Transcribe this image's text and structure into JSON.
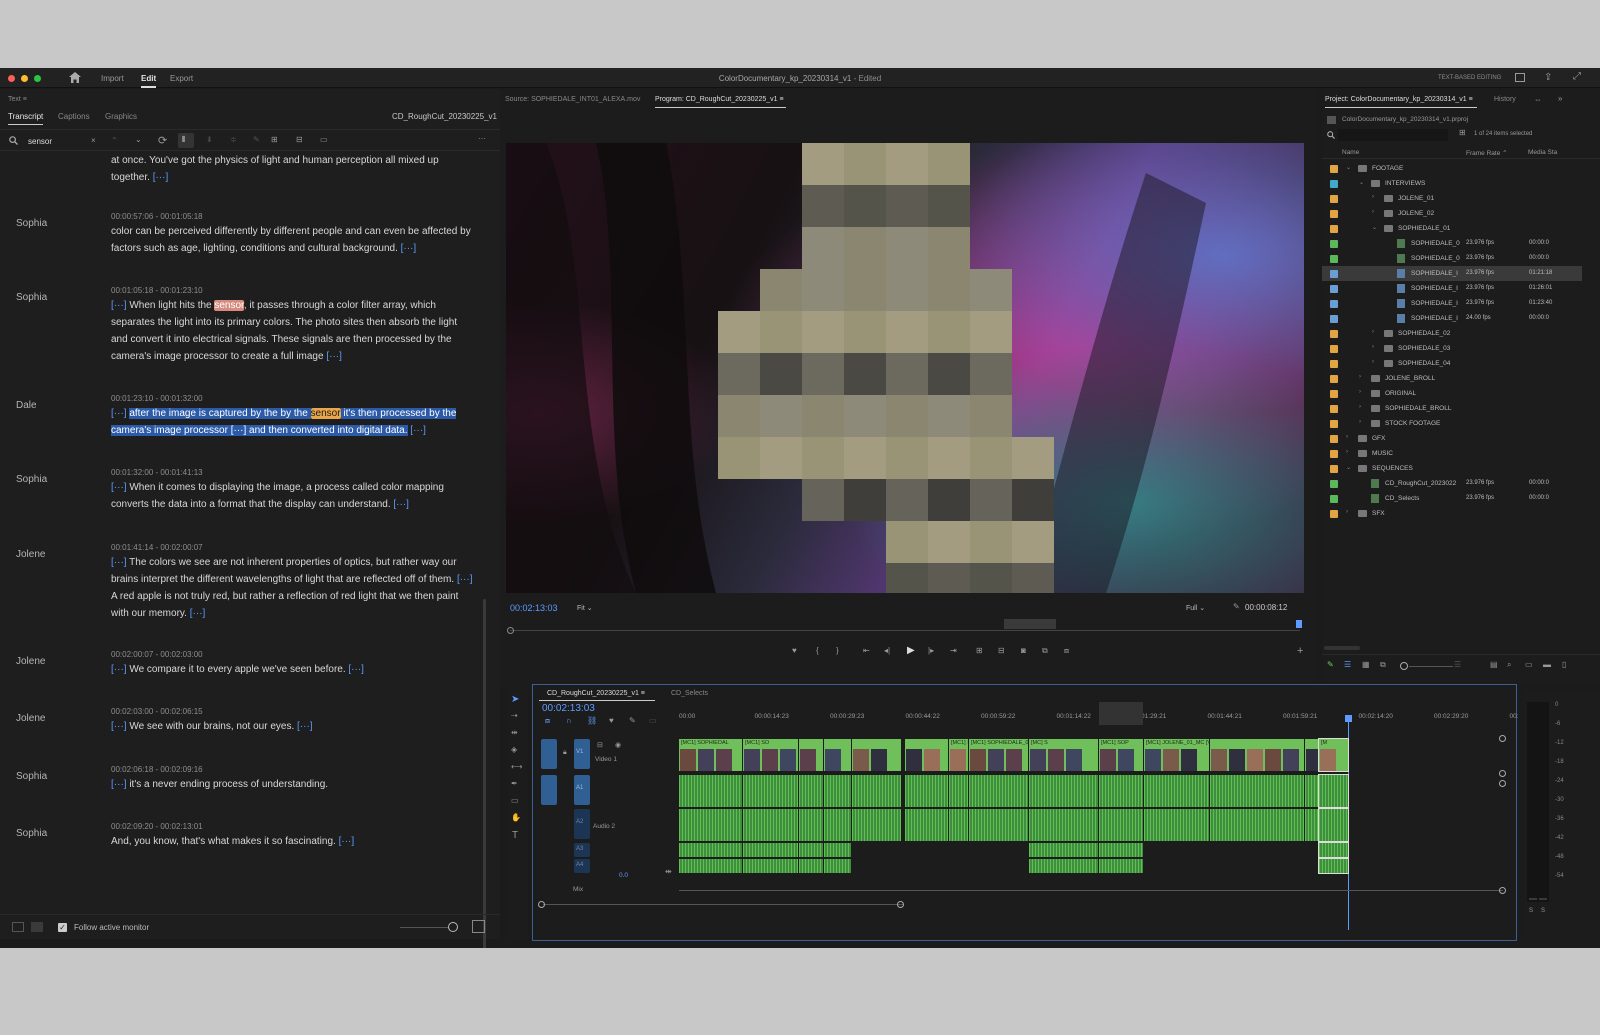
{
  "window": {
    "title": "ColorDocumentary_kp_20230314_v1",
    "status": "- Edited",
    "tabs": [
      "Import",
      "Edit",
      "Export"
    ],
    "active_tab": "Edit",
    "text_based_editing": "TEXT-BASED EDITING"
  },
  "text_panel": {
    "label": "Text",
    "tabs": [
      "Transcript",
      "Captions",
      "Graphics"
    ],
    "sequence_name": "CD_RoughCut_20230225_v1",
    "search_value": "sensor",
    "follow_label": "Follow active monitor",
    "segments": [
      {
        "speaker": "",
        "time": "",
        "parts": [
          {
            "t": "at once. You've got the physics of light and human perception all mixed up together. "
          },
          {
            "t": "[···]",
            "c": "gap"
          }
        ]
      },
      {
        "speaker": "Sophia",
        "time": "00:00:57:06 - 00:01:05:18",
        "parts": [
          {
            "t": "color can be perceived differently by different people and can even be affected by factors such as age, lighting, conditions and cultural background. "
          },
          {
            "t": "[···]",
            "c": "gap"
          }
        ]
      },
      {
        "speaker": "Sophia",
        "time": "00:01:05:18 - 00:01:23:10",
        "parts": [
          {
            "t": "[···] ",
            "c": "gap"
          },
          {
            "t": "When light hits the "
          },
          {
            "t": "sensor",
            "c": "hit"
          },
          {
            "t": ", it passes through a color filter array, which separates the light into its primary colors. The photo sites then absorb the light and convert it into electrical signals. These signals are then processed by the camera's image processor to create a full image "
          },
          {
            "t": "[···]",
            "c": "gap"
          }
        ]
      },
      {
        "speaker": "Dale",
        "time": "00:01:23:10 - 00:01:32:00",
        "parts": [
          {
            "t": "[···] ",
            "c": "gap"
          },
          {
            "t": "after the image is captured by the by the ",
            "c": "hl"
          },
          {
            "t": "sensor",
            "c": "hit2"
          },
          {
            "t": " it's then processed by the camera's image processor ",
            "c": "hl"
          },
          {
            "t": "[···]",
            "c": "gap hl"
          },
          {
            "t": " and then converted into digital data.",
            "c": "hl"
          },
          {
            "t": " [···]",
            "c": "gap"
          }
        ]
      },
      {
        "speaker": "Sophia",
        "time": "00:01:32:00 - 00:01:41:13",
        "parts": [
          {
            "t": "[···] ",
            "c": "gap"
          },
          {
            "t": "When it comes to displaying the image, a process called color mapping converts the data into a format that the display can understand. "
          },
          {
            "t": "[···]",
            "c": "gap"
          }
        ]
      },
      {
        "speaker": "Jolene",
        "time": "00:01:41:14 - 00:02:00:07",
        "parts": [
          {
            "t": "[···] ",
            "c": "gap"
          },
          {
            "t": "The colors we see are not inherent properties of optics, but rather way our brains interpret the different wavelengths of light that are reflected off of them. "
          },
          {
            "t": "[···] ",
            "c": "gap"
          },
          {
            "t": "A red apple is not truly red, but rather a reflection of red light that we then paint with our memory. "
          },
          {
            "t": "[···]",
            "c": "gap"
          }
        ]
      },
      {
        "speaker": "Jolene",
        "time": "00:02:00:07 - 00:02:03:00",
        "parts": [
          {
            "t": "[···] ",
            "c": "gap"
          },
          {
            "t": "We compare it to every apple we've seen before. "
          },
          {
            "t": "[···]",
            "c": "gap"
          }
        ]
      },
      {
        "speaker": "Jolene",
        "time": "00:02:03:00 - 00:02:06:15",
        "parts": [
          {
            "t": "[···] ",
            "c": "gap"
          },
          {
            "t": "We see with our brains, not our eyes. "
          },
          {
            "t": "[···]",
            "c": "gap"
          }
        ]
      },
      {
        "speaker": "Sophia",
        "time": "00:02:06:18 - 00:02:09:16",
        "parts": [
          {
            "t": "[···] ",
            "c": "gap"
          },
          {
            "t": "it's a never ending process of understanding."
          }
        ]
      },
      {
        "speaker": "Sophia",
        "time": "00:02:09:20 - 00:02:13:01",
        "parts": [
          {
            "t": "And, you know, that's what makes it so fascinating. "
          },
          {
            "t": "[···]",
            "c": "gap"
          }
        ]
      }
    ]
  },
  "program_monitor": {
    "source_label": "Source: SOPHIEDALE_INT01_ALEXA.mov",
    "program_label": "Program: CD_RoughCut_20230225_v1",
    "timecode": "00:02:13:03",
    "fit": "Fit",
    "quality": "Full",
    "duration": "00:00:08:12"
  },
  "project_panel": {
    "title": "Project: ColorDocumentary_kp_20230314_v1",
    "history": "History",
    "file": "ColorDocumentary_kp_20230314_v1.prproj",
    "selection": "1 of 24 items selected",
    "columns": [
      "Name",
      "Frame Rate",
      "Media Sta"
    ],
    "rows": [
      {
        "name": "FOOTAGE",
        "depth": 0,
        "kind": "folder",
        "open": true,
        "color": "#e2a544",
        "fps": "",
        "start": ""
      },
      {
        "name": "INTERVIEWS",
        "depth": 1,
        "kind": "folder",
        "open": true,
        "color": "#3fa9c9",
        "fps": "",
        "start": ""
      },
      {
        "name": "JOLENE_01",
        "depth": 2,
        "kind": "folder",
        "open": false,
        "color": "#e2a544",
        "fps": "",
        "start": ""
      },
      {
        "name": "JOLENE_02",
        "depth": 2,
        "kind": "folder",
        "open": false,
        "color": "#e2a544",
        "fps": "",
        "start": ""
      },
      {
        "name": "SOPHIEDALE_01",
        "depth": 2,
        "kind": "folder",
        "open": true,
        "color": "#e2a544",
        "fps": "",
        "start": ""
      },
      {
        "name": "SOPHIEDALE_0",
        "depth": 3,
        "kind": "seq",
        "color": "#5cb85c",
        "fps": "23.976 fps",
        "start": "00:00:0"
      },
      {
        "name": "SOPHIEDALE_0",
        "depth": 3,
        "kind": "seq",
        "color": "#5cb85c",
        "fps": "23.976 fps",
        "start": "00:00:0"
      },
      {
        "name": "SOPHIEDALE_I",
        "depth": 3,
        "kind": "clip",
        "color": "#6b9fd4",
        "fps": "23.976 fps",
        "start": "01:21:18",
        "selected": true
      },
      {
        "name": "SOPHIEDALE_I",
        "depth": 3,
        "kind": "clip",
        "color": "#6b9fd4",
        "fps": "23.976 fps",
        "start": "01:26:01"
      },
      {
        "name": "SOPHIEDALE_I",
        "depth": 3,
        "kind": "clip",
        "color": "#6b9fd4",
        "fps": "23.976 fps",
        "start": "01:23:40"
      },
      {
        "name": "SOPHIEDALE_I",
        "depth": 3,
        "kind": "clip",
        "color": "#6b9fd4",
        "fps": "24.00 fps",
        "start": "00:00:0"
      },
      {
        "name": "SOPHIEDALE_02",
        "depth": 2,
        "kind": "folder",
        "open": false,
        "color": "#e2a544",
        "fps": "",
        "start": ""
      },
      {
        "name": "SOPHIEDALE_03",
        "depth": 2,
        "kind": "folder",
        "open": false,
        "color": "#e2a544",
        "fps": "",
        "start": ""
      },
      {
        "name": "SOPHIEDALE_04",
        "depth": 2,
        "kind": "folder",
        "open": false,
        "color": "#e2a544",
        "fps": "",
        "start": ""
      },
      {
        "name": "JOLENE_BROLL",
        "depth": 1,
        "kind": "folder",
        "open": false,
        "color": "#e2a544",
        "fps": "",
        "start": ""
      },
      {
        "name": "ORIGINAL",
        "depth": 1,
        "kind": "folder",
        "open": false,
        "color": "#e2a544",
        "fps": "",
        "start": ""
      },
      {
        "name": "SOPHIEDALE_BROLL",
        "depth": 1,
        "kind": "folder",
        "open": false,
        "color": "#e2a544",
        "fps": "",
        "start": ""
      },
      {
        "name": "STOCK FOOTAGE",
        "depth": 1,
        "kind": "folder",
        "open": false,
        "color": "#e2a544",
        "fps": "",
        "start": ""
      },
      {
        "name": "GFX",
        "depth": 0,
        "kind": "folder",
        "open": false,
        "color": "#e2a544",
        "fps": "",
        "start": ""
      },
      {
        "name": "MUSIC",
        "depth": 0,
        "kind": "folder",
        "open": false,
        "color": "#e2a544",
        "fps": "",
        "start": ""
      },
      {
        "name": "SEQUENCES",
        "depth": 0,
        "kind": "folder",
        "open": true,
        "color": "#e2a544",
        "fps": "",
        "start": ""
      },
      {
        "name": "CD_RoughCut_2023022",
        "depth": 1,
        "kind": "seq",
        "color": "#5cb85c",
        "fps": "23.976 fps",
        "start": "00:00:0"
      },
      {
        "name": "CD_Selects",
        "depth": 1,
        "kind": "seq",
        "color": "#5cb85c",
        "fps": "23.976 fps",
        "start": "00:00:0"
      },
      {
        "name": "SFX",
        "depth": 0,
        "kind": "folder",
        "open": false,
        "color": "#e2a544",
        "fps": "",
        "start": ""
      }
    ]
  },
  "timeline": {
    "tabs": [
      "CD_RoughCut_20230225_v1",
      "CD_Selects"
    ],
    "timecode": "00:02:13:03",
    "ruler": [
      "00:00",
      "00:00:14:23",
      "00:00:29:23",
      "00:00:44:22",
      "00:00:59:22",
      "00:01:14:22",
      "00:01:29:21",
      "00:01:44:21",
      "00:01:59:21",
      "00:02:14:20",
      "00:02:29:20",
      "00:"
    ],
    "video_track": "Video 1",
    "audio_track": "Audio 2",
    "mix": "Mix",
    "mix_value": "0.0",
    "tracks": [
      "V1",
      "A1",
      "A2",
      "A3",
      "A4"
    ],
    "clip_labels": [
      "[MC1] SOPHIEDAL",
      "[MC1] SO",
      "[MC1] S",
      "[MC1] SOPHIEDALE_01_M",
      "[MC] S",
      "[MC1] SOP",
      "[MC1] JOLENE_01_MC [V]",
      "[M"
    ],
    "meter_scale": [
      "0",
      "-6",
      "-12",
      "-18",
      "-24",
      "-30",
      "-36",
      "-42",
      "-48",
      "-54"
    ]
  }
}
